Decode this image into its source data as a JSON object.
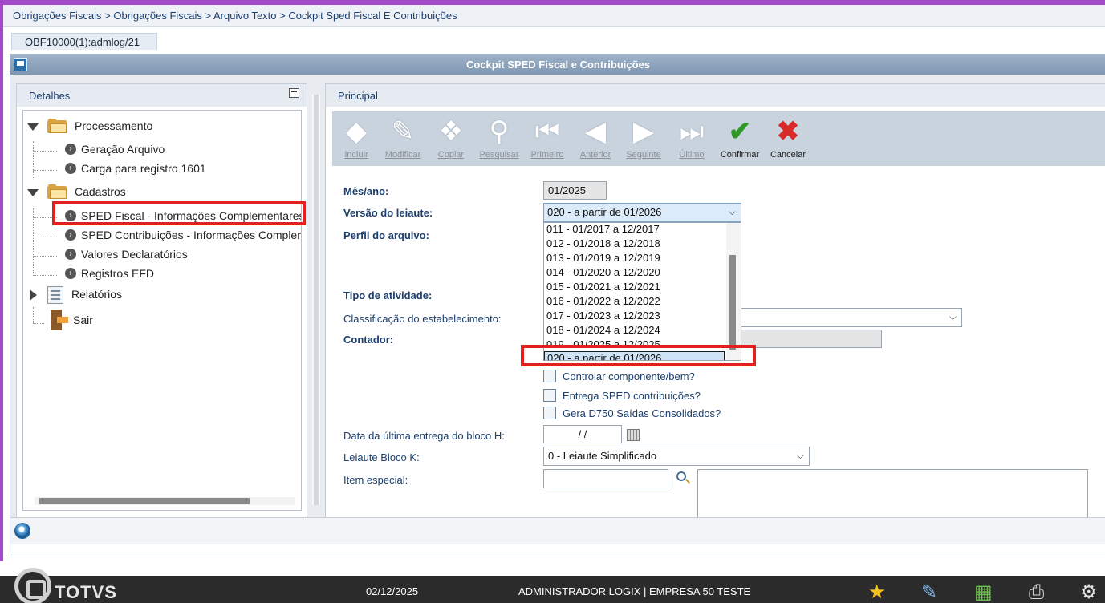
{
  "breadcrumb": "Obrigações Fiscais > Obrigações Fiscais > Arquivo Texto > Cockpit Sped Fiscal E Contribuições",
  "tab": "OBF10000(1):admlog/21",
  "window_title": "Cockpit SPED Fiscal e Contribuições",
  "left_panel": {
    "title": "Detalhes",
    "tree": {
      "processamento": "Processamento",
      "geracao": "Geração Arquivo",
      "carga": "Carga para registro 1601",
      "cadastros": "Cadastros",
      "sped_fiscal": "SPED Fiscal - Informações Complementares",
      "sped_contrib": "SPED Contribuições - Informações Complementares",
      "valores": "Valores Declaratórios",
      "registros": "Registros EFD",
      "relatorios": "Relatórios",
      "sair": "Sair"
    }
  },
  "right_panel": {
    "title": "Principal",
    "toolbar": {
      "incluir": "Incluir",
      "modificar": "Modificar",
      "copiar": "Copiar",
      "pesquisar": "Pesquisar",
      "primeiro": "Primeiro",
      "anterior": "Anterior",
      "seguinte": "Seguinte",
      "ultimo": "Último",
      "confirmar": "Confirmar",
      "cancelar": "Cancelar"
    },
    "form": {
      "mes_ano_label": "Mês/ano:",
      "mes_ano_value": "01/2025",
      "versao_label": "Versão do leiaute:",
      "versao_value": "020 - a partir de 01/2026",
      "versao_options": [
        "011 - 01/2017 a 12/2017",
        "012 - 01/2018 a 12/2018",
        "013 - 01/2019 a 12/2019",
        "014 - 01/2020 a 12/2020",
        "015 - 01/2021 a 12/2021",
        "016 - 01/2022 a 12/2022",
        "017 - 01/2023 a 12/2023",
        "018 - 01/2024 a 12/2024",
        "019 - 01/2025 a 12/2025",
        "020 - a partir de 01/2026"
      ],
      "perfil_label": "Perfil do arquivo:",
      "tipo_label": "Tipo de atividade:",
      "classif_label": "Classificação do estabelecimento:",
      "contador_label": "Contador:",
      "cb_controlar": "Controlar componente/bem?",
      "cb_entrega": "Entrega SPED contribuições?",
      "cb_gera": "Gera D750 Saídas Consolidados?",
      "data_bloco_label": "Data da última entrega do bloco H:",
      "data_bloco_value": "/ /",
      "leiaute_k_label": "Leiaute Bloco K:",
      "leiaute_k_value": "0 - Leiaute Simplificado",
      "item_label": "Item especial:"
    }
  },
  "footer": {
    "brand": "TOTVS",
    "date": "02/12/2025",
    "user": "ADMINISTRADOR LOGIX | EMPRESA 50 TESTE"
  },
  "colors": {
    "accent_purple": "#a24bc9",
    "highlight_red": "#e41f1f",
    "label_blue": "#1c3f6e"
  }
}
